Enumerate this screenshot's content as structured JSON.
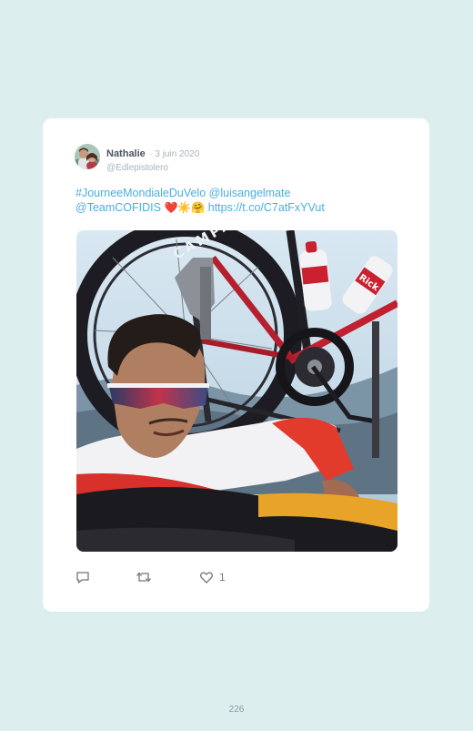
{
  "tweet": {
    "display_name": "Nathalie",
    "date": "· 3 juin 2020",
    "handle": "@Edlepistolero",
    "text": {
      "hashtag": "#JourneeMondialeDuVelo",
      "mention1": "@luisangelmate",
      "mention2": "@TeamCOFIDIS",
      "emojis": "❤️☀️🤗",
      "link": "https://t.co/C7atFxYVut"
    },
    "photo": {
      "wheel_brand": "CAMPAGNOLO",
      "bottle_brand": "Rick"
    },
    "actions": {
      "like_count": "1"
    }
  },
  "page": {
    "number": "226"
  },
  "colors": {
    "background": "#dcefee",
    "card": "#ffffff",
    "link": "#48aee5",
    "name": "#4a5561",
    "meta": "#a8b3bd"
  }
}
